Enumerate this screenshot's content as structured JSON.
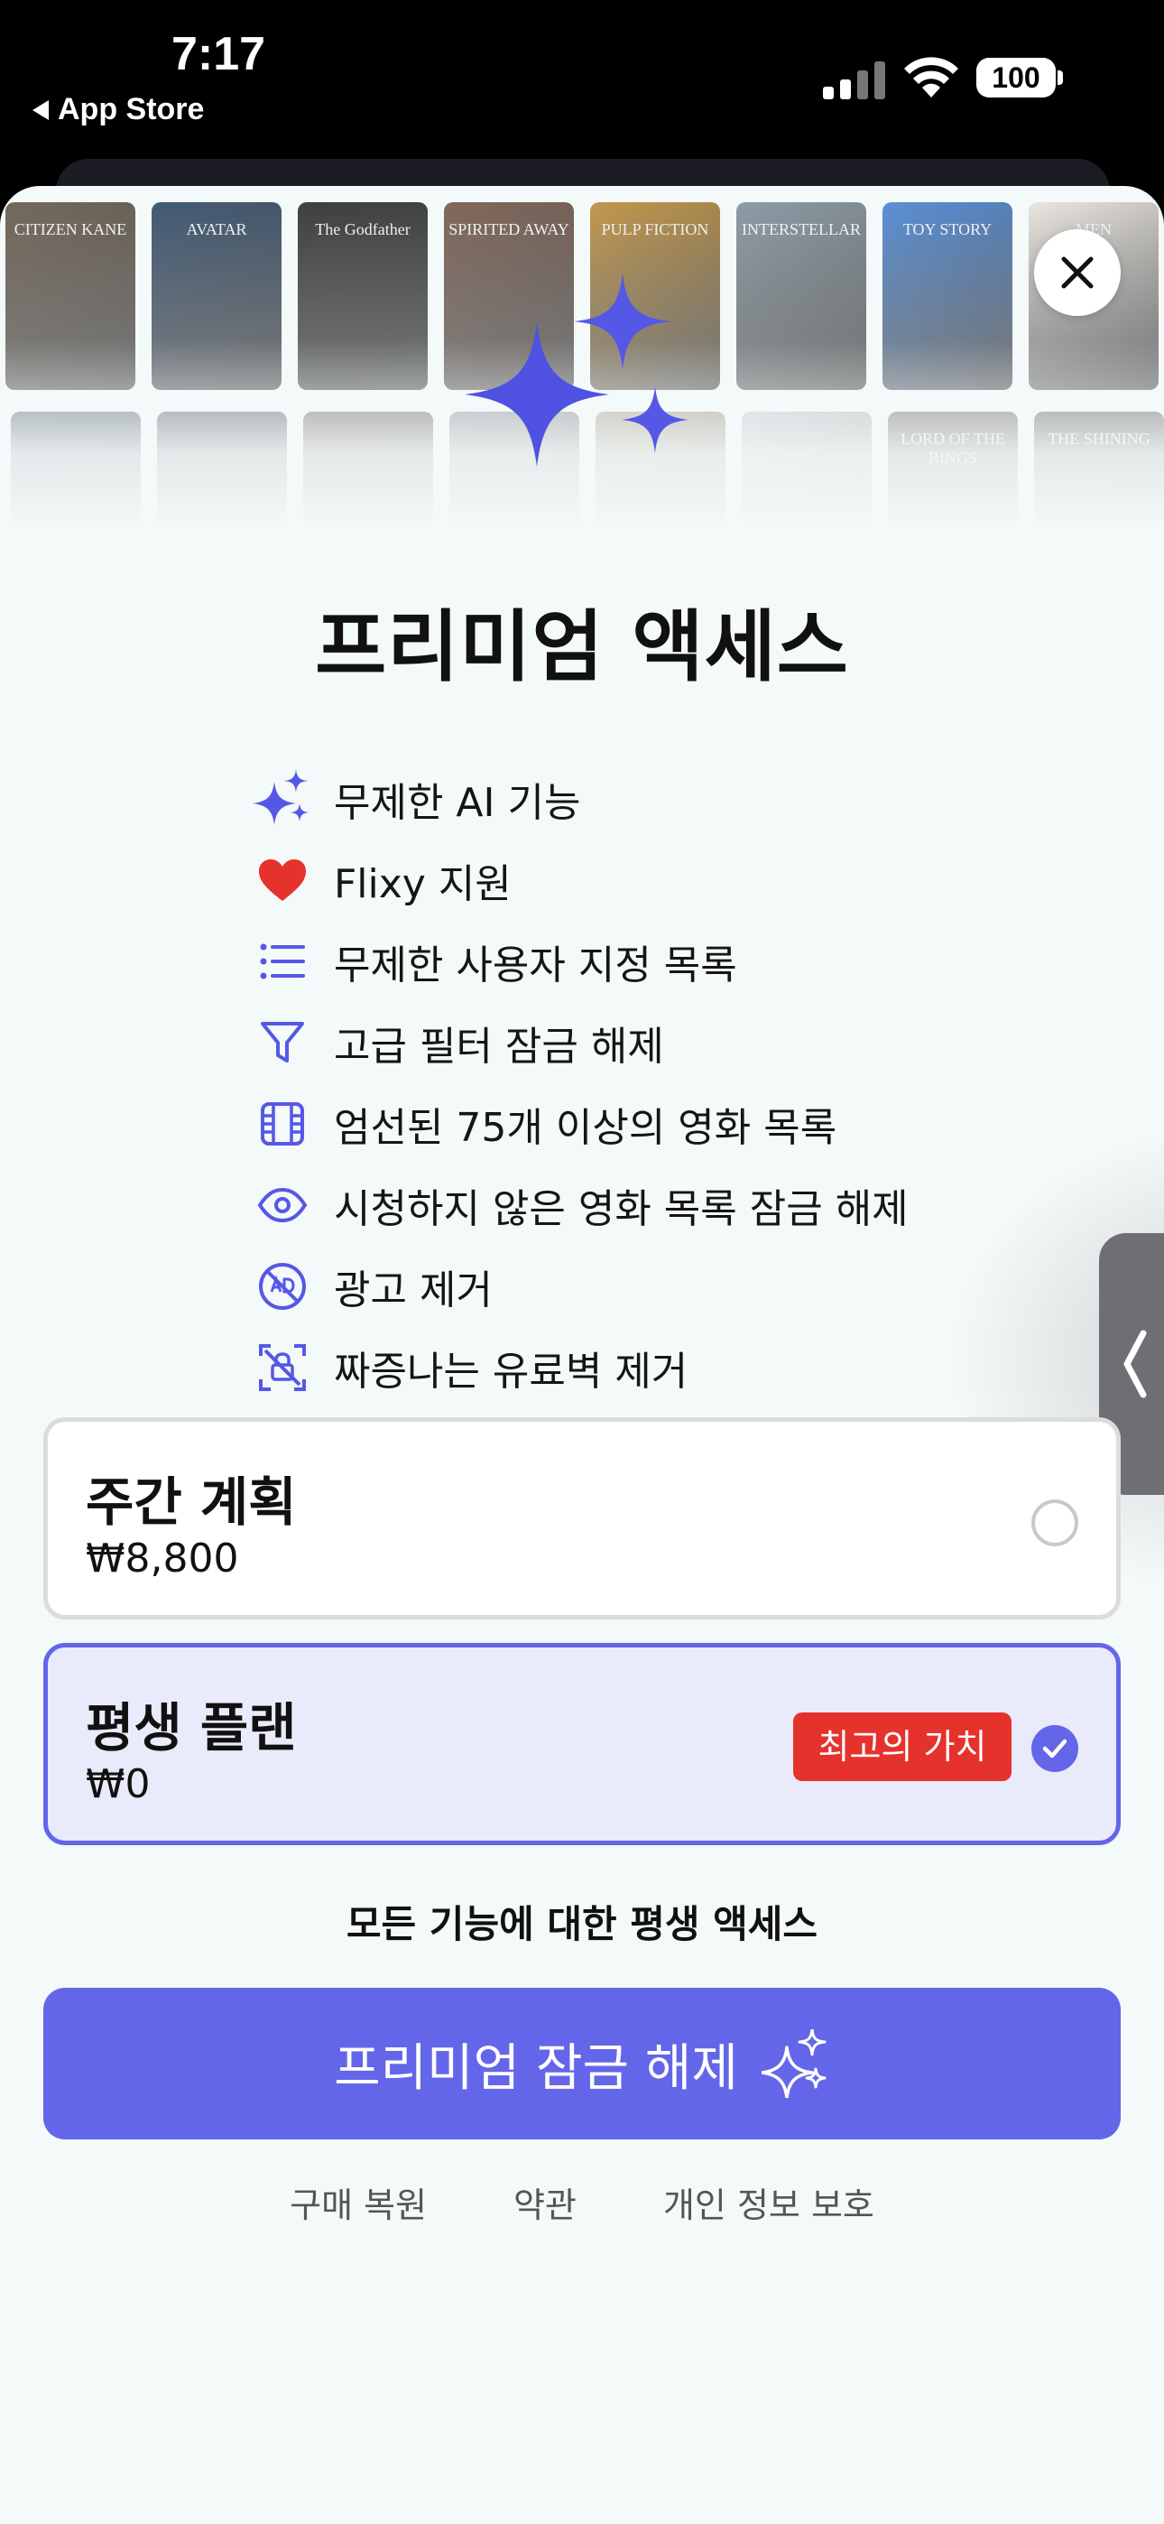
{
  "status_bar": {
    "time": "7:17",
    "back_label": "App Store",
    "battery": "100"
  },
  "posters": {
    "row1": [
      {
        "label": "CITIZEN KANE",
        "color": "#5a4a3a"
      },
      {
        "label": "AVATAR",
        "color": "#1f3a5a"
      },
      {
        "label": "The Godfather",
        "color": "#1a1a1a"
      },
      {
        "label": "SPIRITED AWAY",
        "color": "#6a4a3a"
      },
      {
        "label": "PULP FICTION",
        "color": "#b8842a"
      },
      {
        "label": "INTERSTELLAR",
        "color": "#7a8a96"
      },
      {
        "label": "TOY STORY",
        "color": "#3a7ad0"
      },
      {
        "label": "MEN",
        "color": "#e8e2dc"
      }
    ],
    "row2": [
      {
        "label": "",
        "color": "#23344a"
      },
      {
        "label": "",
        "color": "#1e2a3a"
      },
      {
        "label": "",
        "color": "#3a2e22"
      },
      {
        "label": "",
        "color": "#6a6a72"
      },
      {
        "label": "",
        "color": "#8a7a5a"
      },
      {
        "label": "",
        "color": "#b0b6bc"
      },
      {
        "label": "LORD OF THE RINGS",
        "color": "#3a3428"
      },
      {
        "label": "THE SHINING",
        "color": "#2a2a2a"
      }
    ]
  },
  "title": "프리미엄 액세스",
  "features": [
    {
      "icon": "sparkles-icon",
      "label": "무제한 AI 기능"
    },
    {
      "icon": "heart-icon",
      "label": "Flixy 지원"
    },
    {
      "icon": "list-icon",
      "label": "무제한 사용자 지정 목록"
    },
    {
      "icon": "filter-icon",
      "label": "고급 필터 잠금 해제"
    },
    {
      "icon": "film-icon",
      "label": "엄선된 75개 이상의 영화 목록"
    },
    {
      "icon": "eye-icon",
      "label": "시청하지 않은 영화 목록 잠금 해제"
    },
    {
      "icon": "no-ads-icon",
      "label": "광고 제거"
    },
    {
      "icon": "no-paywall-icon",
      "label": "짜증나는 유료벽 제거"
    }
  ],
  "plans": {
    "weekly": {
      "name": "주간 계획",
      "price": "₩8,800",
      "selected": false
    },
    "lifetime": {
      "name": "평생 플랜",
      "price": "₩0",
      "badge": "최고의 가치",
      "selected": true
    }
  },
  "plan_subtitle": "모든 기능에 대한 평생 액세스",
  "cta_label": "프리미엄 잠금 해제",
  "footer": {
    "restore": "구매 복원",
    "terms": "약관",
    "privacy": "개인 정보 보호"
  },
  "colors": {
    "accent": "#6466e9",
    "badge": "#e5322d",
    "heart": "#e5322d",
    "background": "#f4f9f9"
  }
}
